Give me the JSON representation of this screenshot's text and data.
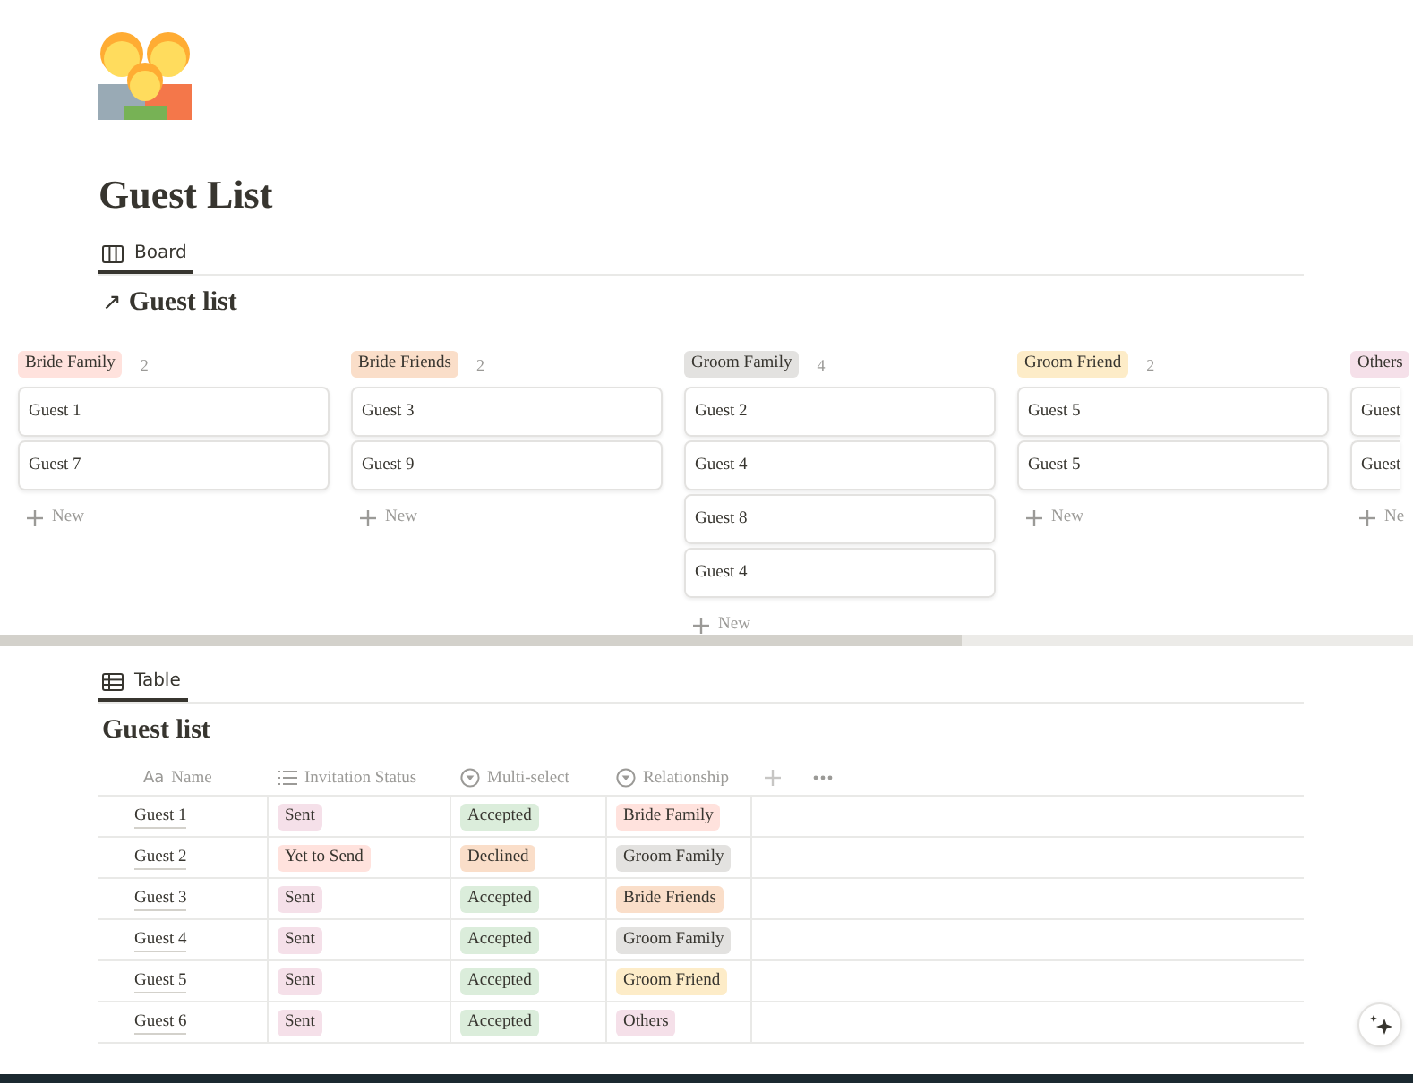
{
  "page": {
    "title": "Guest List"
  },
  "board_view": {
    "tab": {
      "label": "Board",
      "selected": true
    },
    "heading_arrow": "↗",
    "heading": "Guest list",
    "groups": [
      {
        "label": "Bride Family",
        "color": "#ffe2dd",
        "count": "2",
        "cards": [
          "Guest 1",
          "Guest 7"
        ],
        "new": "New"
      },
      {
        "label": "Bride Friends",
        "color": "#fadec9",
        "count": "2",
        "cards": [
          "Guest 3",
          "Guest 9"
        ],
        "new": "New"
      },
      {
        "label": "Groom Family",
        "color": "#e3e2e0",
        "count": "4",
        "cards": [
          "Guest 2",
          "Guest 4",
          "Guest 8",
          "Guest 4"
        ],
        "new": "New"
      },
      {
        "label": "Groom Friend",
        "color": "#fdecc8",
        "count": "2",
        "cards": [
          "Guest 5",
          "Guest 5"
        ],
        "new": "New"
      },
      {
        "label": "Others",
        "color": "#f5e0e9",
        "cards": [
          "Guest",
          "Guest"
        ],
        "new": "Ne"
      }
    ]
  },
  "table_view": {
    "tab": {
      "label": "Table",
      "selected": true
    },
    "heading": "Guest list",
    "columns": [
      {
        "label": "Name",
        "kind": "title",
        "prefix": "Aa"
      },
      {
        "label": "Invitation Status",
        "kind": "list"
      },
      {
        "label": "Multi-select",
        "kind": "select"
      },
      {
        "label": "Relationship",
        "kind": "select"
      }
    ],
    "rows": [
      {
        "name": "Guest 1",
        "status": {
          "text": "Sent",
          "color": "#f5e0e9"
        },
        "multi": {
          "text": "Accepted",
          "color": "#dbeddb"
        },
        "relationship": {
          "text": "Bride Family",
          "color": "#ffe2dd"
        }
      },
      {
        "name": "Guest 2",
        "status": {
          "text": "Yet to Send",
          "color": "#ffe2dd"
        },
        "multi": {
          "text": "Declined",
          "color": "#fadec9"
        },
        "relationship": {
          "text": "Groom Family",
          "color": "#e3e2e0"
        }
      },
      {
        "name": "Guest 3",
        "status": {
          "text": "Sent",
          "color": "#f5e0e9"
        },
        "multi": {
          "text": "Accepted",
          "color": "#dbeddb"
        },
        "relationship": {
          "text": "Bride Friends",
          "color": "#fadec9"
        }
      },
      {
        "name": "Guest 4",
        "status": {
          "text": "Sent",
          "color": "#f5e0e9"
        },
        "multi": {
          "text": "Accepted",
          "color": "#dbeddb"
        },
        "relationship": {
          "text": "Groom Family",
          "color": "#e3e2e0"
        }
      },
      {
        "name": "Guest 5",
        "status": {
          "text": "Sent",
          "color": "#f5e0e9"
        },
        "multi": {
          "text": "Accepted",
          "color": "#dbeddb"
        },
        "relationship": {
          "text": "Groom Friend",
          "color": "#fdecc8"
        }
      },
      {
        "name": "Guest 6",
        "status": {
          "text": "Sent",
          "color": "#f5e0e9"
        },
        "multi": {
          "text": "Accepted",
          "color": "#dbeddb"
        },
        "relationship": {
          "text": "Others",
          "color": "#f5e0e9"
        }
      }
    ]
  }
}
